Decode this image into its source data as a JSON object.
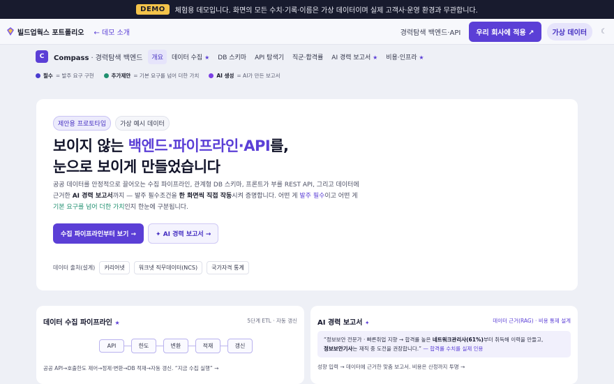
{
  "demo_bar": {
    "badge": "DEMO",
    "text": "체험용 데모입니다. 화면의 모든 수치·기록·이름은 가상 데이터이며 실제 고객사·운영 환경과 무관합니다."
  },
  "top_nav": {
    "brand": "빌드업웍스 포트폴리오",
    "back_link": "← 데모 소개",
    "subtitle": "경력탐색 백엔드·API",
    "apply_button": "우리 회사에 적용 ↗",
    "virtual_badge": "가상 데이터",
    "theme_icon": "☾"
  },
  "sub_nav": {
    "logo_letter": "C",
    "product": "Compass",
    "product_sub": "· 경력탐색 백엔드",
    "tabs": [
      {
        "label": "개요",
        "star": ""
      },
      {
        "label": "데이터 수집",
        "star": "★"
      },
      {
        "label": "DB 스키마",
        "star": ""
      },
      {
        "label": "API 탐색기",
        "star": ""
      },
      {
        "label": "직군·합격률",
        "star": ""
      },
      {
        "label": "AI 경력 보고서",
        "star": "★"
      },
      {
        "label": "비용·인프라",
        "star": "★"
      }
    ]
  },
  "legend": [
    {
      "label": "필수",
      "desc": "= 발주 요구 구현",
      "color": "#4a3ccf"
    },
    {
      "label": "추가제안",
      "desc": "= 기본 요구를 넘어 더한 가치",
      "color": "#1f8f6f"
    },
    {
      "label": "AI 생성",
      "desc": "= AI가 만든 보고서",
      "color": "#7b3fe4"
    }
  ],
  "hero": {
    "chip_primary": "제안용 프로토타입",
    "chip_secondary": "가상 예시 데이터",
    "title_pre": "보이지 않는 ",
    "title_highlight": "백엔드·파이프라인·API",
    "title_post": "를,",
    "title_line2": "눈으로 보이게 만들었습니다",
    "desc_1": "공공 데이터를 안정적으로 끌어오는 수집 파이프라인, 관계형 DB 스키마, 프론트가 부를 REST API, 그리고 데이터에",
    "desc_2a": "근거한 ",
    "desc_2b": "AI 경력 보고서",
    "desc_2c": "까지 — 발주 필수조건을 ",
    "desc_2d": "한 화면씩 직접 작동",
    "desc_2e": "시켜 증명합니다. 어떤 게 ",
    "desc_2f": "발주 필수",
    "desc_2g": "이고 어떤 게",
    "desc_3a": "기본 요구를 넘어 더한 가치",
    "desc_3b": "인지 한눈에 구분됩니다.",
    "cta_primary": "수집 파이프라인부터 보기 →",
    "cta_secondary": "✦ AI 경력 보고서 →",
    "source_label": "데이터 출처(설계)",
    "sources": [
      "커리어넷",
      "워크넷 직무데이터(NCS)",
      "국가자격 통계"
    ]
  },
  "card_pipeline": {
    "title": "데이터 수집 파이프라인",
    "star": "★",
    "meta": "5단계 ETL · 자동 갱신",
    "steps": [
      "API",
      "한도",
      "변환",
      "적재",
      "갱신"
    ],
    "footer": "공공 API→호출한도 제어→정제·변환→DB 적재→자동 갱신. “지금 수집 실행” →"
  },
  "card_report": {
    "title": "AI 경력 보고서",
    "star": "✦",
    "meta": "데이터 근거(RAG) · 비용 통제 설계",
    "quote_1a": "“정보보안 전문가 · 빠른취업 지향 → 합격률 높은 ",
    "quote_1b": "네트워크관리사(61%)",
    "quote_1c": "부터 취득해 이력을 만들고,",
    "quote_2a": "정보보안기사",
    "quote_2b": "는 재직 중 도전을 권장합니다.”",
    "quote_2c": " — 합격률 수치를 실제 인용",
    "footer": "성향 입력 → 데이터에 근거한 맞춤 보고서. 비용은 산정까지 투명 →"
  }
}
